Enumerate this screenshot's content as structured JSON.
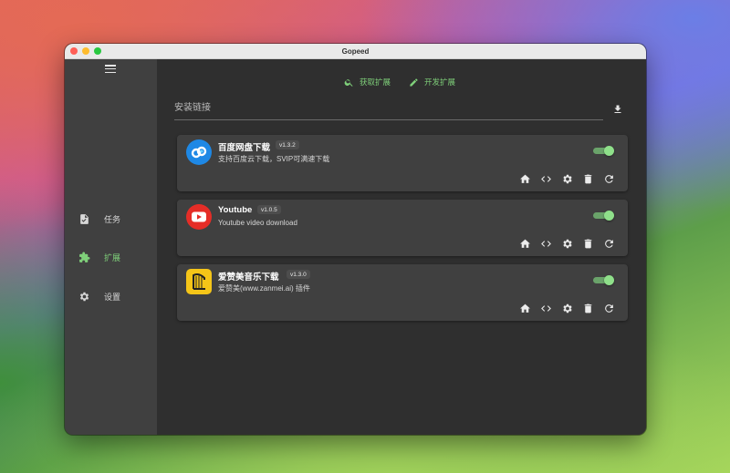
{
  "window": {
    "title": "Gopeed"
  },
  "sidebar": {
    "items": [
      {
        "label": "任务",
        "icon": "task-icon",
        "active": false
      },
      {
        "label": "扩展",
        "icon": "extension-icon",
        "active": true
      },
      {
        "label": "设置",
        "icon": "gear-icon",
        "active": false
      }
    ]
  },
  "toolbar": {
    "get_extensions_label": "获取扩展",
    "develop_extensions_label": "开发扩展"
  },
  "install": {
    "placeholder": "安装链接"
  },
  "extensions": [
    {
      "name": "百度网盘下载",
      "version": "v1.3.2",
      "description": "支持百度云下载，SVIP可满速下载",
      "enabled": true,
      "icon": "baidu-netdisk-logo-icon"
    },
    {
      "name": "Youtube",
      "version": "v1.0.5",
      "description": "Youtube video download",
      "enabled": true,
      "icon": "youtube-logo-icon"
    },
    {
      "name": "爱赞美音乐下载",
      "version": "v1.3.0",
      "description": "爱赞美(www.zanmei.ai) 插件",
      "enabled": true,
      "icon": "harp-logo-icon"
    }
  ],
  "colors": {
    "accent": "#7fd07a",
    "sidebar": "#404040",
    "background": "#2f2f2f",
    "card": "#404040"
  }
}
